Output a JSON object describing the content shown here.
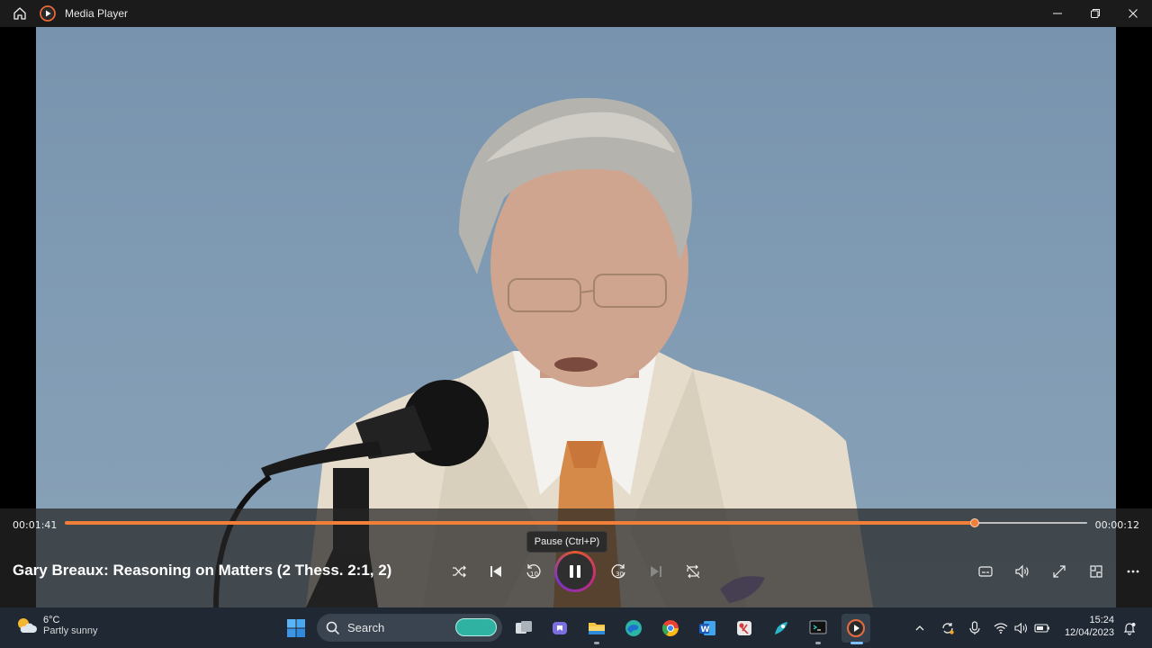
{
  "window": {
    "title": "Media Player"
  },
  "player": {
    "elapsed": "00:01:41",
    "remaining": "00:00:12",
    "progress_fraction": 0.89,
    "tooltip": "Pause (Ctrl+P)",
    "media_title": "Gary Breaux: Reasoning on Matters (2 Thess. 2:1, 2)",
    "accent_color": "#f07f3a",
    "controls": [
      "shuffle-icon",
      "previous-icon",
      "rewind-10-icon",
      "pause-icon",
      "forward-30-icon",
      "next-icon",
      "repeat-off-icon"
    ],
    "right_controls": [
      "subtitles-icon",
      "volume-icon",
      "fullscreen-icon",
      "mini-player-icon",
      "more-icon"
    ]
  },
  "taskbar": {
    "weather_temp": "6°C",
    "weather_desc": "Partly sunny",
    "search_placeholder": "Search",
    "clock_time": "15:24",
    "clock_date": "12/04/2023",
    "apps": [
      "start-icon",
      "task-view-icon",
      "teams-icon",
      "file-explorer-icon",
      "edge-icon",
      "chrome-icon",
      "word-icon",
      "snipping-tool-icon",
      "app-icon",
      "terminal-icon",
      "media-player-icon"
    ],
    "tray": [
      "chevron-up-icon",
      "sync-icon",
      "microphone-icon",
      "wifi-icon",
      "speaker-icon",
      "battery-icon",
      "notification-icon"
    ]
  }
}
